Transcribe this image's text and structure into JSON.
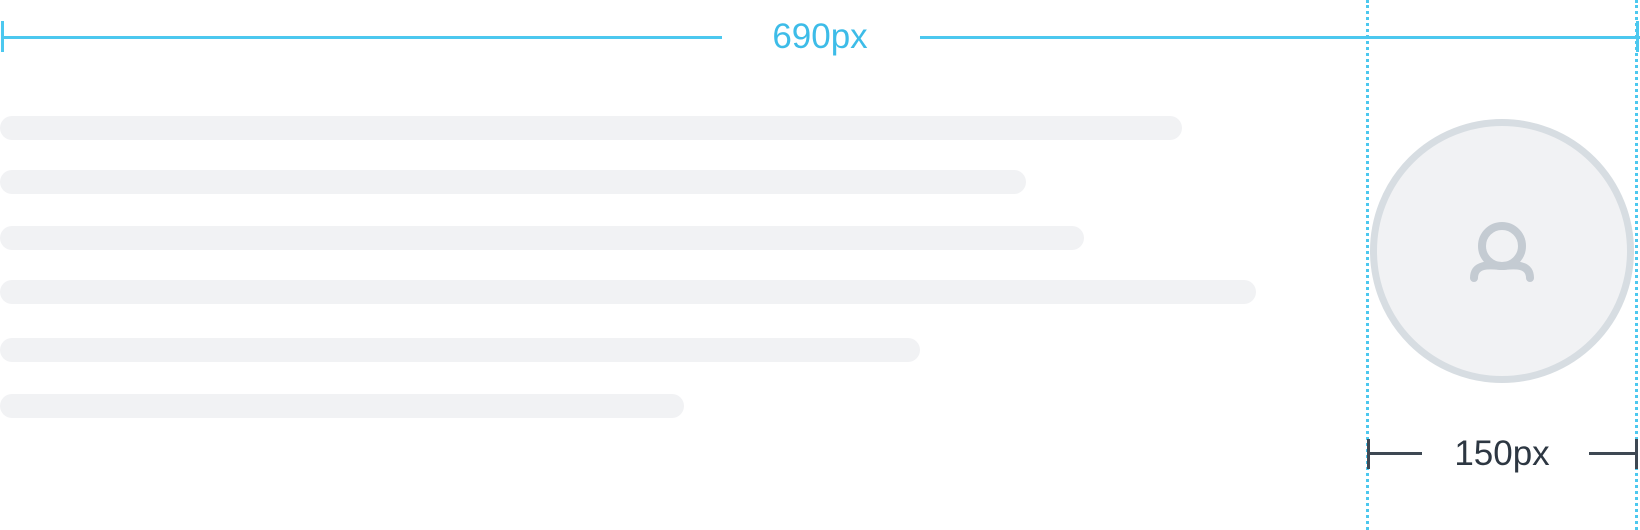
{
  "container_width_label": "690px",
  "avatar_width_label": "150px",
  "avatar": {
    "icon": "user-icon"
  },
  "skeleton_line_count": 6,
  "colors": {
    "guide": "#4cc8ef",
    "dimension_text": "#3dbce8",
    "dark_dimension": "#3e4853",
    "placeholder": "#f1f2f4",
    "avatar_border": "#d7dde2",
    "icon": "#c4cbd2"
  }
}
